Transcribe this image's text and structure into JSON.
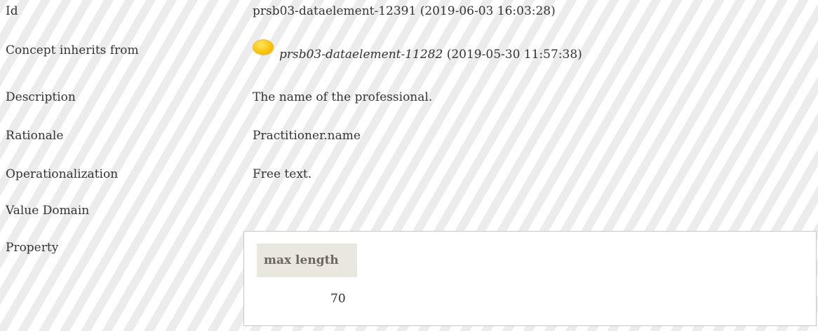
{
  "rows": {
    "id": {
      "label": "Id",
      "value": "prsb03-dataelement-12391 (2019-06-03 16:03:28)"
    },
    "inherits": {
      "label": "Concept inherits from",
      "ref": "prsb03-dataelement-11282",
      "date": " (2019-05-30 11:57:38)",
      "icon": "yellow-concept-circle-icon",
      "icon_color": "#f9c40a"
    },
    "description": {
      "label": "Description",
      "value": "The name of the professional."
    },
    "rationale": {
      "label": "Rationale",
      "value": "Practitioner.name"
    },
    "operationalization": {
      "label": "Operationalization",
      "value": "Free text."
    },
    "value_domain": {
      "label": "Value Domain"
    },
    "property": {
      "label": "Property",
      "header": "max length",
      "value": "70"
    }
  },
  "colors": {
    "text": "#333333",
    "stripe": "#ececec",
    "header_bg": "#eae6e0",
    "header_text": "#6d665d",
    "panel_border": "#c8c8c8"
  }
}
